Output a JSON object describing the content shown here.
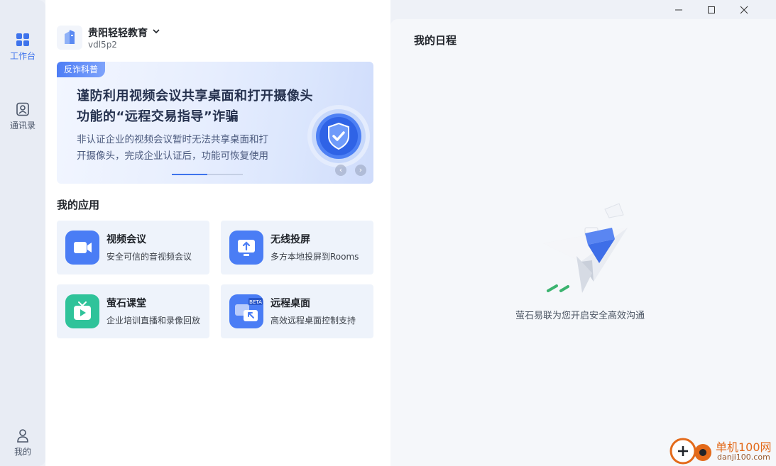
{
  "sidebar": {
    "items": [
      {
        "label": "工作台",
        "icon": "grid-icon"
      },
      {
        "label": "通讯录",
        "icon": "contacts-icon"
      }
    ],
    "bottom": {
      "label": "我的",
      "icon": "user-icon"
    }
  },
  "org": {
    "name": "贵阳轻轻教育",
    "code": "vdl5p2"
  },
  "banner": {
    "tag": "反诈科普",
    "title_line1": "谨防利用视频会议共享桌面和打开摄像头",
    "title_line2": "功能的“远程交易指导”诈骗",
    "desc_line1": "非认证企业的视频会议暂时无法共享桌面和打",
    "desc_line2": "开摄像头，完成企业认证后，功能可恢复使用",
    "prev": "‹",
    "next": "›"
  },
  "apps": {
    "title": "我的应用",
    "items": [
      {
        "name": "视频会议",
        "desc": "安全可信的音视频会议",
        "icon": "video-camera-icon",
        "color": "#4a7df5"
      },
      {
        "name": "无线投屏",
        "desc": "多方本地投屏到Rooms",
        "icon": "screen-cast-icon",
        "color": "#4a7df5"
      },
      {
        "name": "萤石课堂",
        "desc": "企业培训直播和录像回放",
        "icon": "tv-play-icon",
        "color": "#2fc39a"
      },
      {
        "name": "远程桌面",
        "desc": "高效远程桌面控制支持",
        "icon": "remote-desktop-icon",
        "color": "#4a7df5",
        "badge": "BETA"
      }
    ]
  },
  "schedule": {
    "title": "我的日程",
    "empty_text": "萤石易联为您开启安全高效沟通"
  },
  "watermark": {
    "main": "单机100网",
    "sub": "danji100.com"
  },
  "colors": {
    "accent": "#3e73ec",
    "sidebar_bg": "#e8ecf4",
    "card_bg": "#eef3fb"
  }
}
